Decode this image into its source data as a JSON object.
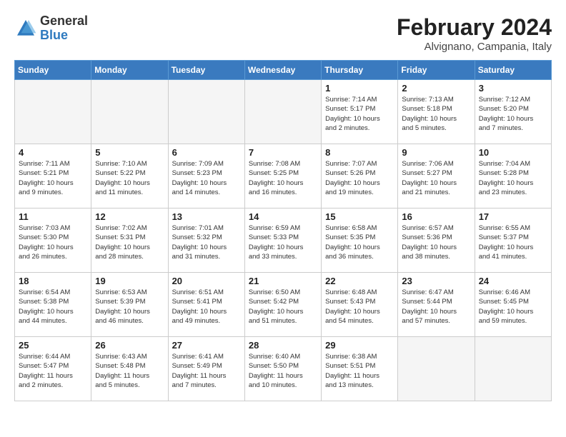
{
  "logo": {
    "general": "General",
    "blue": "Blue"
  },
  "title": "February 2024",
  "subtitle": "Alvignano, Campania, Italy",
  "days_of_week": [
    "Sunday",
    "Monday",
    "Tuesday",
    "Wednesday",
    "Thursday",
    "Friday",
    "Saturday"
  ],
  "weeks": [
    [
      {
        "day": "",
        "info": ""
      },
      {
        "day": "",
        "info": ""
      },
      {
        "day": "",
        "info": ""
      },
      {
        "day": "",
        "info": ""
      },
      {
        "day": "1",
        "info": "Sunrise: 7:14 AM\nSunset: 5:17 PM\nDaylight: 10 hours\nand 2 minutes."
      },
      {
        "day": "2",
        "info": "Sunrise: 7:13 AM\nSunset: 5:18 PM\nDaylight: 10 hours\nand 5 minutes."
      },
      {
        "day": "3",
        "info": "Sunrise: 7:12 AM\nSunset: 5:20 PM\nDaylight: 10 hours\nand 7 minutes."
      }
    ],
    [
      {
        "day": "4",
        "info": "Sunrise: 7:11 AM\nSunset: 5:21 PM\nDaylight: 10 hours\nand 9 minutes."
      },
      {
        "day": "5",
        "info": "Sunrise: 7:10 AM\nSunset: 5:22 PM\nDaylight: 10 hours\nand 11 minutes."
      },
      {
        "day": "6",
        "info": "Sunrise: 7:09 AM\nSunset: 5:23 PM\nDaylight: 10 hours\nand 14 minutes."
      },
      {
        "day": "7",
        "info": "Sunrise: 7:08 AM\nSunset: 5:25 PM\nDaylight: 10 hours\nand 16 minutes."
      },
      {
        "day": "8",
        "info": "Sunrise: 7:07 AM\nSunset: 5:26 PM\nDaylight: 10 hours\nand 19 minutes."
      },
      {
        "day": "9",
        "info": "Sunrise: 7:06 AM\nSunset: 5:27 PM\nDaylight: 10 hours\nand 21 minutes."
      },
      {
        "day": "10",
        "info": "Sunrise: 7:04 AM\nSunset: 5:28 PM\nDaylight: 10 hours\nand 23 minutes."
      }
    ],
    [
      {
        "day": "11",
        "info": "Sunrise: 7:03 AM\nSunset: 5:30 PM\nDaylight: 10 hours\nand 26 minutes."
      },
      {
        "day": "12",
        "info": "Sunrise: 7:02 AM\nSunset: 5:31 PM\nDaylight: 10 hours\nand 28 minutes."
      },
      {
        "day": "13",
        "info": "Sunrise: 7:01 AM\nSunset: 5:32 PM\nDaylight: 10 hours\nand 31 minutes."
      },
      {
        "day": "14",
        "info": "Sunrise: 6:59 AM\nSunset: 5:33 PM\nDaylight: 10 hours\nand 33 minutes."
      },
      {
        "day": "15",
        "info": "Sunrise: 6:58 AM\nSunset: 5:35 PM\nDaylight: 10 hours\nand 36 minutes."
      },
      {
        "day": "16",
        "info": "Sunrise: 6:57 AM\nSunset: 5:36 PM\nDaylight: 10 hours\nand 38 minutes."
      },
      {
        "day": "17",
        "info": "Sunrise: 6:55 AM\nSunset: 5:37 PM\nDaylight: 10 hours\nand 41 minutes."
      }
    ],
    [
      {
        "day": "18",
        "info": "Sunrise: 6:54 AM\nSunset: 5:38 PM\nDaylight: 10 hours\nand 44 minutes."
      },
      {
        "day": "19",
        "info": "Sunrise: 6:53 AM\nSunset: 5:39 PM\nDaylight: 10 hours\nand 46 minutes."
      },
      {
        "day": "20",
        "info": "Sunrise: 6:51 AM\nSunset: 5:41 PM\nDaylight: 10 hours\nand 49 minutes."
      },
      {
        "day": "21",
        "info": "Sunrise: 6:50 AM\nSunset: 5:42 PM\nDaylight: 10 hours\nand 51 minutes."
      },
      {
        "day": "22",
        "info": "Sunrise: 6:48 AM\nSunset: 5:43 PM\nDaylight: 10 hours\nand 54 minutes."
      },
      {
        "day": "23",
        "info": "Sunrise: 6:47 AM\nSunset: 5:44 PM\nDaylight: 10 hours\nand 57 minutes."
      },
      {
        "day": "24",
        "info": "Sunrise: 6:46 AM\nSunset: 5:45 PM\nDaylight: 10 hours\nand 59 minutes."
      }
    ],
    [
      {
        "day": "25",
        "info": "Sunrise: 6:44 AM\nSunset: 5:47 PM\nDaylight: 11 hours\nand 2 minutes."
      },
      {
        "day": "26",
        "info": "Sunrise: 6:43 AM\nSunset: 5:48 PM\nDaylight: 11 hours\nand 5 minutes."
      },
      {
        "day": "27",
        "info": "Sunrise: 6:41 AM\nSunset: 5:49 PM\nDaylight: 11 hours\nand 7 minutes."
      },
      {
        "day": "28",
        "info": "Sunrise: 6:40 AM\nSunset: 5:50 PM\nDaylight: 11 hours\nand 10 minutes."
      },
      {
        "day": "29",
        "info": "Sunrise: 6:38 AM\nSunset: 5:51 PM\nDaylight: 11 hours\nand 13 minutes."
      },
      {
        "day": "",
        "info": ""
      },
      {
        "day": "",
        "info": ""
      }
    ]
  ]
}
